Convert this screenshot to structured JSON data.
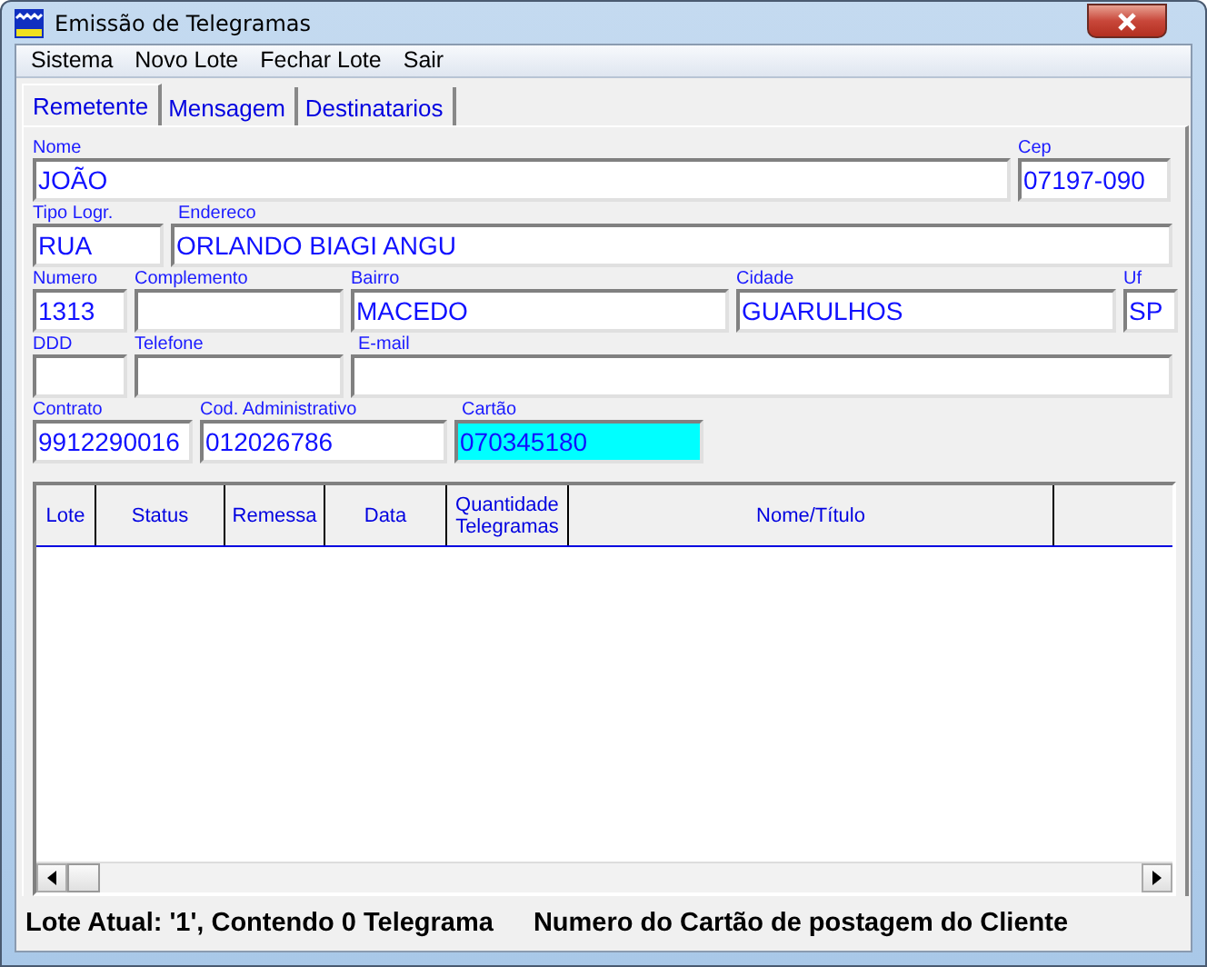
{
  "window": {
    "title": "Emissão de Telegramas"
  },
  "menu": [
    "Sistema",
    "Novo Lote",
    "Fechar Lote",
    "Sair"
  ],
  "tabs": [
    {
      "label": "Remetente",
      "selected": true
    },
    {
      "label": "Mensagem",
      "selected": false
    },
    {
      "label": "Destinatarios",
      "selected": false
    }
  ],
  "field_rows": [
    [
      {
        "label": "Nome",
        "value": "JOÃO",
        "focused": false
      },
      {
        "label": "Cep",
        "value": "07197-090",
        "focused": false
      }
    ],
    [
      {
        "label": "Tipo Logr.",
        "value": "RUA",
        "focused": false
      },
      {
        "label": "Endereco",
        "value": "ORLANDO BIAGI ANGU",
        "focused": false
      }
    ],
    [
      {
        "label": "Numero",
        "value": "1313",
        "focused": false
      },
      {
        "label": "Complemento",
        "focused": false
      },
      {
        "label": "Bairro",
        "value": "MACEDO",
        "focused": false
      },
      {
        "label": "Cidade",
        "value": "GUARULHOS",
        "focused": false
      },
      {
        "label": "Uf",
        "value": "SP",
        "focused": false
      }
    ],
    [
      {
        "label": "DDD",
        "focused": false
      },
      {
        "label": "Telefone",
        "focused": false
      },
      {
        "label": "E-mail",
        "focused": false
      }
    ],
    [
      {
        "label": "Contrato",
        "value": "9912290016",
        "focused": false
      },
      {
        "label": "Cod. Administrativo",
        "value": "012026786",
        "focused": false
      },
      {
        "label": "Cartão",
        "value": "070345180",
        "focused": true
      }
    ]
  ],
  "table": {
    "columns": [
      "Lote",
      "Status",
      "Remessa",
      "Data",
      "Quantidade Telegramas",
      "Nome/Título"
    ]
  },
  "status_bar": [
    "Lote Atual: '1', Contendo 0 Telegrama",
    "Numero do Cartão de postagem do Cliente"
  ]
}
